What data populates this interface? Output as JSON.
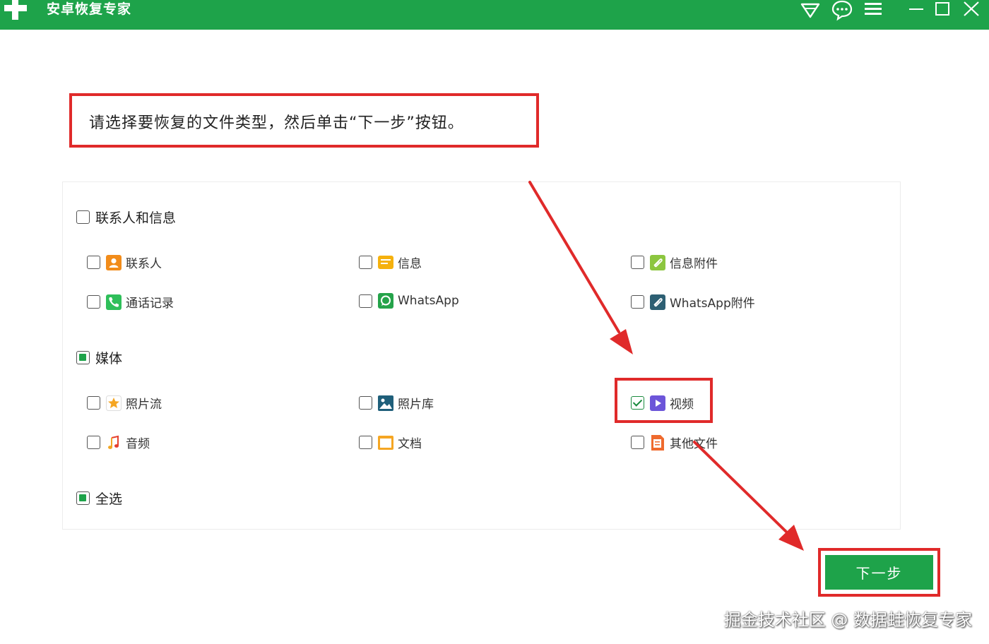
{
  "app": {
    "title": "安卓恢复专家"
  },
  "titlebar": {
    "icons": [
      "diamond-icon",
      "chat-icon",
      "menu-icon",
      "minimize-icon",
      "maximize-icon",
      "close-icon"
    ]
  },
  "instruction": "请选择要恢复的文件类型，然后单击“下一步”按钮。",
  "groups": {
    "contacts_messages": {
      "label": "联系人和信息",
      "state": "unchecked",
      "items": [
        {
          "label": "联系人",
          "icon": "contact-icon",
          "checked": false
        },
        {
          "label": "信息",
          "icon": "message-icon",
          "checked": false
        },
        {
          "label": "信息附件",
          "icon": "message-attachment-icon",
          "checked": false
        },
        {
          "label": "通话记录",
          "icon": "call-log-icon",
          "checked": false
        },
        {
          "label": "WhatsApp",
          "icon": "whatsapp-icon",
          "checked": false
        },
        {
          "label": "WhatsApp附件",
          "icon": "whatsapp-attachment-icon",
          "checked": false
        }
      ]
    },
    "media": {
      "label": "媒体",
      "state": "partial",
      "items": [
        {
          "label": "照片流",
          "icon": "photo-stream-icon",
          "checked": false
        },
        {
          "label": "照片库",
          "icon": "photo-library-icon",
          "checked": false
        },
        {
          "label": "视频",
          "icon": "video-icon",
          "checked": true
        },
        {
          "label": "音频",
          "icon": "audio-icon",
          "checked": false
        },
        {
          "label": "文档",
          "icon": "document-icon",
          "checked": false
        },
        {
          "label": "其他文件",
          "icon": "other-files-icon",
          "checked": false
        }
      ]
    },
    "select_all": {
      "label": "全选",
      "state": "partial"
    }
  },
  "next_button": {
    "label": "下一步"
  },
  "watermark": "掘金技术社区 @ 数据蛙恢复专家",
  "colors": {
    "brand_green": "#1ea34a",
    "highlight_red": "#e02a2a"
  }
}
